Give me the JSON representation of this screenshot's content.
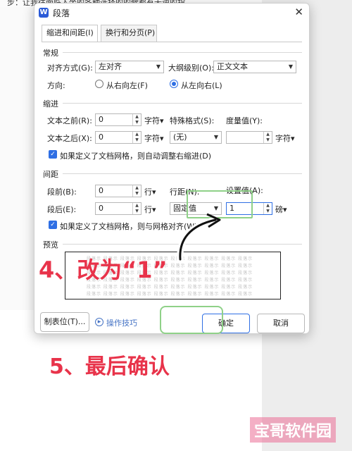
{
  "background": {
    "top_text": "步：让我往面临入坐的各种选择的的候都有无逆的指"
  },
  "dialog": {
    "title": "段落",
    "app_icon_letter": "W",
    "close_glyph": "✕",
    "tabs": [
      {
        "label": "缩进和间距(I)",
        "active": true
      },
      {
        "label": "换行和分页(P)",
        "active": false
      }
    ],
    "general": {
      "heading": "常规",
      "alignment_label": "对齐方式(G):",
      "alignment_value": "左对齐",
      "outline_label": "大纲级别(O):",
      "outline_value": "正文文本",
      "direction_label": "方向:",
      "rtl_label": "从右向左(F)",
      "ltr_label": "从左向右(L)",
      "direction_selected": "ltr"
    },
    "indent": {
      "heading": "缩进",
      "before_label": "文本之前(R):",
      "before_value": "0",
      "before_unit": "字符▾",
      "after_label": "文本之后(X):",
      "after_value": "0",
      "after_unit": "字符▾",
      "special_label": "特殊格式(S):",
      "special_value": "(无)",
      "measure_label": "度量值(Y):",
      "measure_value": "",
      "measure_unit": "字符▾",
      "auto_adjust_checked": true,
      "auto_adjust_label": "如果定义了文档网格，则自动调整右缩进(D)"
    },
    "spacing": {
      "heading": "间距",
      "before_label": "段前(B):",
      "before_value": "0",
      "before_unit": "行▾",
      "after_label": "段后(E):",
      "after_value": "0",
      "after_unit": "行▾",
      "line_label": "行距(N):",
      "line_value": "固定值",
      "setting_label": "设置值(A):",
      "setting_value": "1",
      "setting_unit": "磅▾",
      "grid_align_checked": true,
      "grid_align_label": "如果定义了文档网格，则与网格对齐(W)"
    },
    "preview": {
      "heading": "预览",
      "ghost_text": "段落示 段落示 段落示 段落示 段落示 段落示 段落示 段落示 段落示 段落示"
    },
    "footer": {
      "tabs_button": "制表位(T)...",
      "tips_label": "操作技巧",
      "ok_button": "确定",
      "cancel_button": "取消"
    }
  },
  "annotations": {
    "step4": "4、改为“1”",
    "step5": "5、最后确认",
    "highlight_color": "#8fd188",
    "annotation_color": "#e8334a"
  },
  "watermark": "宝哥软件园"
}
